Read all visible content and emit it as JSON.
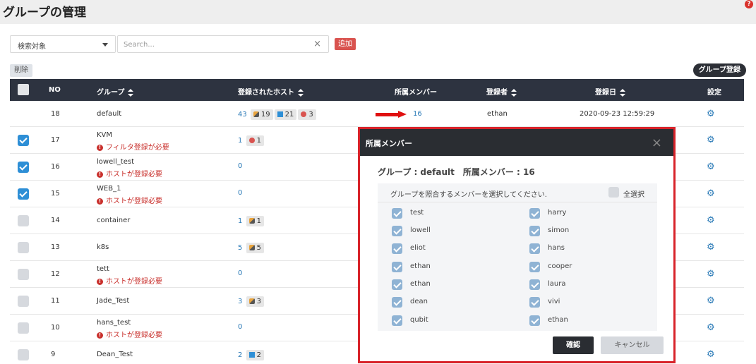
{
  "page": {
    "title": "グループの管理",
    "help": "?"
  },
  "toolbar": {
    "filter_label": "検索対象",
    "search_placeholder": "Search...",
    "clear": "×",
    "add_label": "追加",
    "delete_label": "削除",
    "register_label": "グループ登録"
  },
  "table": {
    "headers": {
      "no": "NO",
      "group": "グループ",
      "hosts": "登録されたホスト",
      "members": "所属メンバー",
      "registrant": "登録者",
      "date": "登録日",
      "settings": "設定"
    },
    "rows": [
      {
        "checked": null,
        "no": "18",
        "group": "default",
        "warning": "",
        "hosts": "43",
        "badges": [
          {
            "icon": "linux-icon",
            "v": "19"
          },
          {
            "icon": "windows-icon",
            "v": "21"
          },
          {
            "icon": "error-icon",
            "v": "3"
          }
        ],
        "members": "16",
        "registrant": "ethan",
        "date": "2020-09-23 12:59:29"
      },
      {
        "checked": true,
        "no": "17",
        "group": "KVM",
        "warning": "フィルタ登録が必要",
        "hosts": "1",
        "badges": [
          {
            "icon": "error-icon",
            "v": "1"
          }
        ]
      },
      {
        "checked": true,
        "no": "16",
        "group": "lowell_test",
        "warning": "ホストが登録必要",
        "hosts": "0",
        "badges": []
      },
      {
        "checked": true,
        "no": "15",
        "group": "WEB_1",
        "warning": "ホストが登録必要",
        "hosts": "0",
        "badges": []
      },
      {
        "checked": false,
        "no": "14",
        "group": "container",
        "warning": "",
        "hosts": "1",
        "badges": [
          {
            "icon": "linux-icon",
            "v": "1"
          }
        ]
      },
      {
        "checked": false,
        "no": "13",
        "group": "k8s",
        "warning": "",
        "hosts": "5",
        "badges": [
          {
            "icon": "linux-icon",
            "v": "5"
          }
        ]
      },
      {
        "checked": false,
        "no": "12",
        "group": "tett",
        "warning": "ホストが登録必要",
        "hosts": "0",
        "badges": []
      },
      {
        "checked": false,
        "no": "11",
        "group": "Jade_Test",
        "warning": "",
        "hosts": "3",
        "badges": [
          {
            "icon": "linux-icon",
            "v": "3"
          }
        ]
      },
      {
        "checked": false,
        "no": "10",
        "group": "hans_test",
        "warning": "ホストが登録必要",
        "hosts": "0",
        "badges": []
      },
      {
        "checked": false,
        "no": "9",
        "group": "Dean_Test",
        "warning": "",
        "hosts": "2",
        "badges": [
          {
            "icon": "windows-icon",
            "v": "2"
          }
        ]
      }
    ]
  },
  "modal": {
    "title": "所属メンバー",
    "close": "×",
    "subtitle": "グループ : default　所属メンバー : 16",
    "list_header": "グループを照合するメンバーを選択してください.",
    "select_all": "全選択",
    "members_left": [
      "test",
      "lowell",
      "eliot",
      "ethan",
      "ethan",
      "dean",
      "qubit"
    ],
    "members_right": [
      "harry",
      "simon",
      "hans",
      "cooper",
      "laura",
      "vivi",
      "ethan"
    ],
    "confirm_label": "確認",
    "cancel_label": "キャンセル"
  },
  "colors": {
    "accent": "#2e8fd6",
    "danger": "#d9534f",
    "header": "#2d3340",
    "highlight": "#d8232a"
  }
}
